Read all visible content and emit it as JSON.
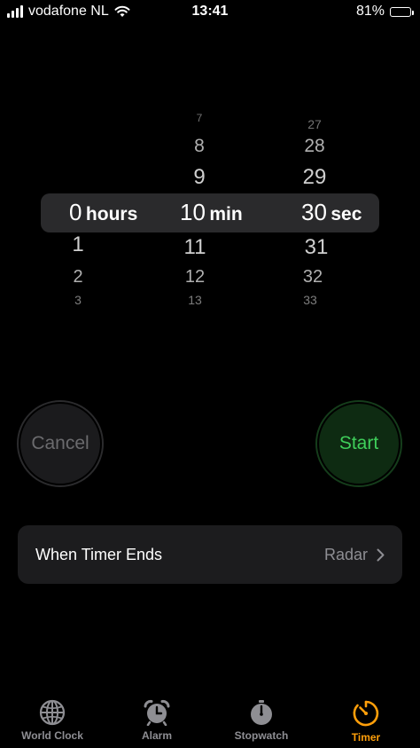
{
  "status_bar": {
    "carrier": "vodafone NL",
    "time": "13:41",
    "battery": "81%"
  },
  "picker": {
    "hours": {
      "above": [
        "",
        "",
        ""
      ],
      "selected": "0",
      "unit": "hours",
      "below": [
        "1",
        "2",
        "3"
      ]
    },
    "minutes": {
      "above": [
        "7",
        "8",
        "9"
      ],
      "selected": "10",
      "unit": "min",
      "below": [
        "11",
        "12",
        "13"
      ]
    },
    "seconds": {
      "above": [
        "27",
        "28",
        "29"
      ],
      "selected": "30",
      "unit": "sec",
      "below": [
        "31",
        "32",
        "33"
      ]
    }
  },
  "buttons": {
    "cancel": "Cancel",
    "start": "Start"
  },
  "timer_end": {
    "label": "When Timer Ends",
    "value": "Radar"
  },
  "tabs": [
    {
      "label": "World Clock",
      "icon": "globe-icon"
    },
    {
      "label": "Alarm",
      "icon": "alarm-clock-icon"
    },
    {
      "label": "Stopwatch",
      "icon": "stopwatch-icon"
    },
    {
      "label": "Timer",
      "icon": "timer-icon",
      "active": true
    }
  ],
  "colors": {
    "accent": "#ff9f0a",
    "start_green": "#3fce5a"
  }
}
